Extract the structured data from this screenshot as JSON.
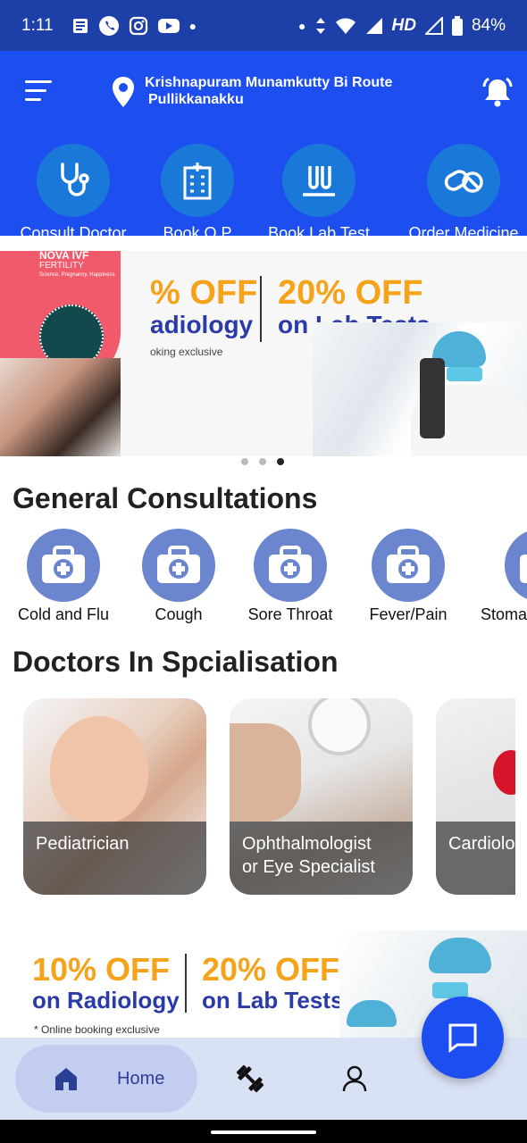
{
  "status_bar": {
    "time": "1:11",
    "net": "HD",
    "battery": "84%"
  },
  "header": {
    "location_line1": "Krishnapuram Munamkutty Bi Route",
    "location_line2": "Pullikkanakku",
    "quick_actions": [
      {
        "label": "Consult Doctor",
        "icon": "stethoscope-icon"
      },
      {
        "label": "Book O P",
        "icon": "hospital-icon"
      },
      {
        "label": "Book Lab Test",
        "icon": "test-tubes-icon"
      },
      {
        "label": "Order Medicine",
        "icon": "pills-icon"
      }
    ]
  },
  "banner": {
    "offer1_a": "% OFF",
    "offer1_b": "adiology",
    "offer2_a": "20% OFF",
    "offer2_b": "on Lab Tests",
    "note": "oking exclusive",
    "brand": "NOVA IVF",
    "brand_sub": "FERTILITY",
    "brand_tag": "Science. Pregnancy. Happiness",
    "active_dot": 3
  },
  "sections": {
    "general": "General Consultations",
    "specialisation": "Doctors In Spcialisation"
  },
  "general_consultations": [
    "Cold and Flu",
    "Cough",
    "Sore Throat",
    "Fever/Pain",
    "Stoma"
  ],
  "specialists": [
    {
      "line1": "Pediatrician",
      "line2": ""
    },
    {
      "line1": "Ophthalmologist",
      "line2": "or Eye Specialist"
    },
    {
      "line1": "Cardiolo",
      "line2": ""
    }
  ],
  "promo": {
    "a1": "10% OFF",
    "a2": "on Radiology",
    "b1": "20% OFF",
    "b2": "on Lab Tests",
    "note": "* Online booking exclusive"
  },
  "bottom_nav": {
    "home": "Home"
  },
  "colors": {
    "header": "#1c4ef0",
    "status": "#1d3fa8",
    "accent_orange": "#f5a31a",
    "text_navy": "#2a3aa8"
  }
}
